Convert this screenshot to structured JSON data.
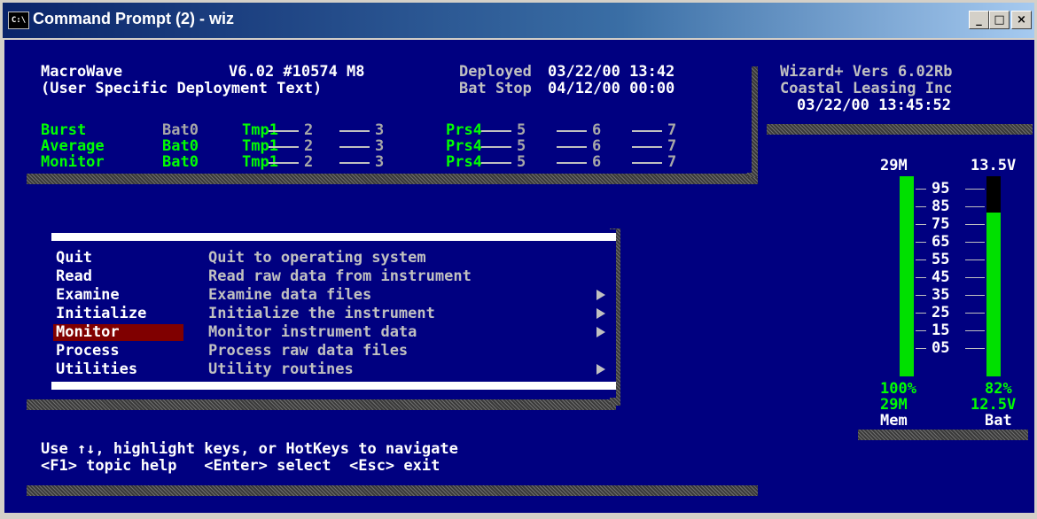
{
  "window": {
    "title": "Command Prompt (2) - wiz",
    "icon_label": "C:\\",
    "buttons": {
      "minimize": "_",
      "maximize": "□",
      "close": "×"
    }
  },
  "header": {
    "app_name": "MacroWave",
    "version": "V6.02 #10574 M8",
    "deployed_label": "Deployed",
    "deployed_value": "03/22/00 13:42",
    "user_text": "(User Specific Deployment Text)",
    "batstop_label": "Bat Stop",
    "batstop_value": "04/12/00 00:00"
  },
  "channels": {
    "rows": [
      {
        "label": "Burst",
        "cells": [
          "Bat0",
          "Tmp1",
          "2",
          "3",
          "Prs4",
          "5",
          "6",
          "7"
        ]
      },
      {
        "label": "Average",
        "cells": [
          "Bat0",
          "Tmp1",
          "2",
          "3",
          "Prs4",
          "5",
          "6",
          "7"
        ]
      },
      {
        "label": "Monitor",
        "cells": [
          "Bat0",
          "Tmp1",
          "2",
          "3",
          "Prs4",
          "5",
          "6",
          "7"
        ]
      }
    ]
  },
  "info": {
    "wizard_version": "Wizard+ Vers 6.02Rb",
    "company": "Coastal Leasing Inc",
    "datetime": "03/22/00 13:45:52"
  },
  "menu": {
    "items": [
      {
        "label": "Quit",
        "desc": "Quit to operating system",
        "submenu": false
      },
      {
        "label": "Read",
        "desc": "Read raw data from instrument",
        "submenu": false
      },
      {
        "label": "Examine",
        "desc": "Examine data files",
        "submenu": true
      },
      {
        "label": "Initialize",
        "desc": "Initialize the instrument",
        "submenu": true
      },
      {
        "label": "Monitor",
        "desc": "Monitor instrument data",
        "submenu": true,
        "selected": true
      },
      {
        "label": "Process",
        "desc": "Process raw data files",
        "submenu": false
      },
      {
        "label": "Utilities",
        "desc": "Utility routines",
        "submenu": true
      }
    ]
  },
  "help": {
    "line1": "Use ↑↓, highlight keys, or HotKeys to navigate",
    "line2": "<F1> topic help   <Enter> select  <Esc> exit"
  },
  "gauge": {
    "mem_top": "29M",
    "bat_top": "13.5V",
    "scale": [
      "95",
      "85",
      "75",
      "65",
      "55",
      "45",
      "35",
      "25",
      "15",
      "05"
    ],
    "mem_percent": "100%",
    "bat_percent": "82%",
    "mem_value": "29M",
    "bat_value": "12.5V",
    "mem_label": "Mem",
    "bat_label": "Bat",
    "mem_fill": 1.0,
    "bat_fill": 0.82
  },
  "colors": {
    "console_bg": "#000080",
    "accent_green": "#00ff00",
    "highlight_bg": "#800000"
  }
}
